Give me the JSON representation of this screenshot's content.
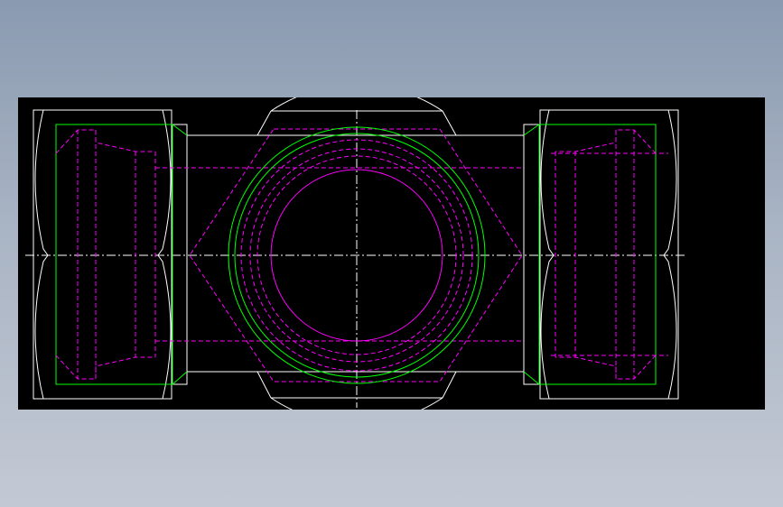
{
  "viewport": {
    "background_color": "#000000",
    "surround_gradient": [
      "#8a9ab0",
      "#c3c9d4"
    ]
  },
  "drawing": {
    "description_colors": {
      "outline": "#ffffff",
      "hidden_lines": "#ff00ff",
      "thread": "#00ff00",
      "center_lines": "#ffffff"
    },
    "views": [
      "left-side-view",
      "front-view-hex",
      "right-side-view"
    ]
  }
}
